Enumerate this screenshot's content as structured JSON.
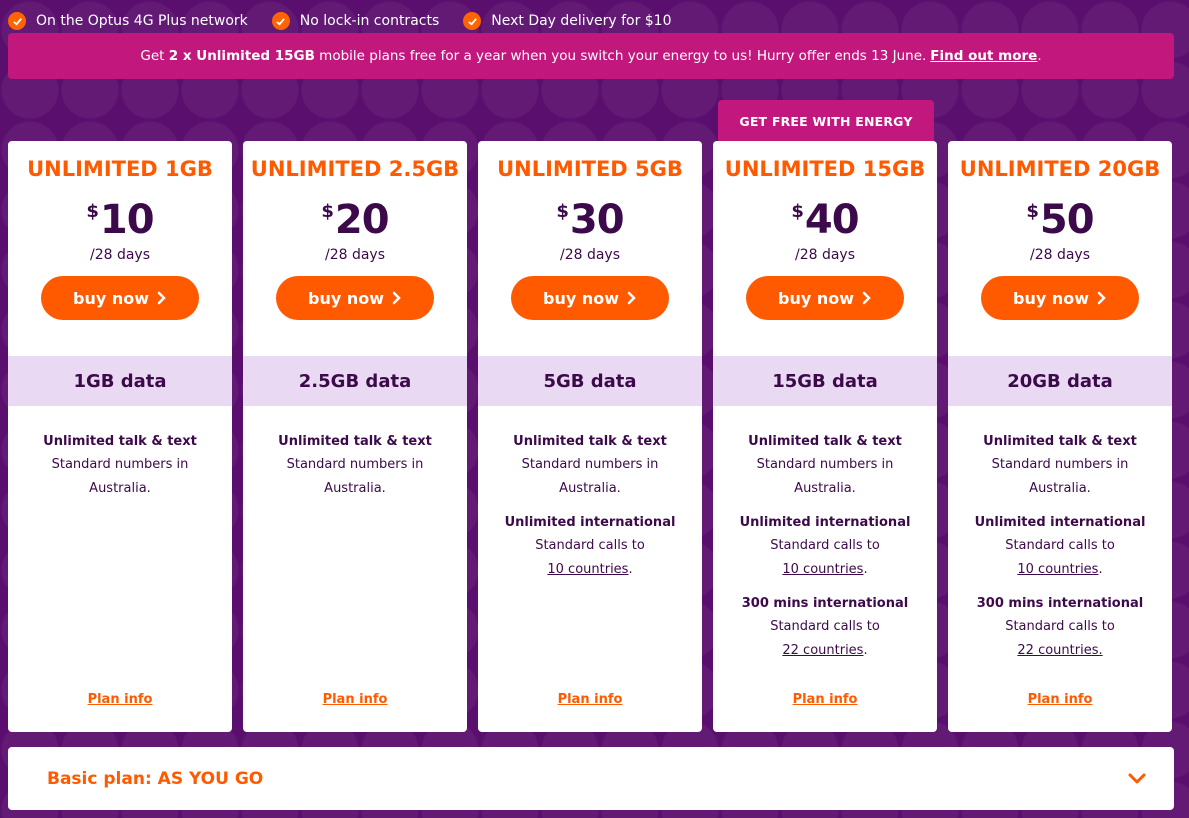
{
  "usps": [
    {
      "label": "On the Optus 4G Plus network"
    },
    {
      "label": "No lock-in contracts"
    },
    {
      "label": "Next Day delivery for $10"
    }
  ],
  "promo": {
    "prefix": "Get ",
    "highlight": "2 x Unlimited 15GB",
    "suffix": " mobile plans free for a year when you switch your energy to us! Hurry offer ends 13 June.",
    "link": "Find out more",
    "end": "."
  },
  "ribbon": "GET FREE WITH ENERGY",
  "currency": "$",
  "plans": [
    {
      "name": "UNLIMITED 1GB",
      "price": "10",
      "period": "/28 days",
      "buy": "buy now",
      "data": "1GB data",
      "features": [
        {
          "title": "Unlimited talk & text",
          "desc": "Standard numbers in Australia."
        }
      ],
      "plan_info": "Plan info"
    },
    {
      "name": "UNLIMITED 2.5GB",
      "price": "20",
      "period": "/28 days",
      "buy": "buy now",
      "data": "2.5GB data",
      "features": [
        {
          "title": "Unlimited talk & text",
          "desc": "Standard numbers in Australia."
        }
      ],
      "plan_info": "Plan info"
    },
    {
      "name": "UNLIMITED 5GB",
      "price": "30",
      "period": "/28 days",
      "buy": "buy now",
      "data": "5GB data",
      "features": [
        {
          "title": "Unlimited talk & text",
          "desc": "Standard numbers in Australia."
        },
        {
          "title": "Unlimited international",
          "desc_pre": "Standard calls to",
          "link": "10 countries",
          "desc_post": "."
        }
      ],
      "plan_info": "Plan info"
    },
    {
      "name": "UNLIMITED 15GB",
      "price": "40",
      "period": "/28 days",
      "buy": "buy now",
      "data": "15GB data",
      "features": [
        {
          "title": "Unlimited talk & text",
          "desc": "Standard numbers in Australia."
        },
        {
          "title": "Unlimited international",
          "desc_pre": "Standard calls to",
          "link": "10 countries",
          "desc_post": "."
        },
        {
          "title": "300 mins international",
          "desc_pre": "Standard calls to",
          "link": "22 countries",
          "desc_post": "."
        }
      ],
      "plan_info": "Plan info"
    },
    {
      "name": "UNLIMITED 20GB",
      "price": "50",
      "period": "/28 days",
      "buy": "buy now",
      "data": "20GB data",
      "features": [
        {
          "title": "Unlimited talk & text",
          "desc": "Standard numbers in Australia."
        },
        {
          "title": "Unlimited international",
          "desc_pre": "Standard calls to",
          "link": "10 countries",
          "desc_post": "."
        },
        {
          "title": "300 mins international",
          "desc_pre": "Standard calls to",
          "link": "22 countries.",
          "desc_post": ""
        }
      ],
      "plan_info": "Plan info"
    }
  ],
  "basic_plan": {
    "label": "Basic plan: AS YOU GO"
  },
  "colors": {
    "accent": "#ff5a00",
    "background": "#5a0e6e",
    "promo": "#c2187e",
    "data_band": "#ead9f2",
    "text": "#3c0a4a"
  },
  "icons": {
    "usp": "check-icon",
    "buy": "chevron-right-icon",
    "basic": "chevron-down-icon"
  }
}
